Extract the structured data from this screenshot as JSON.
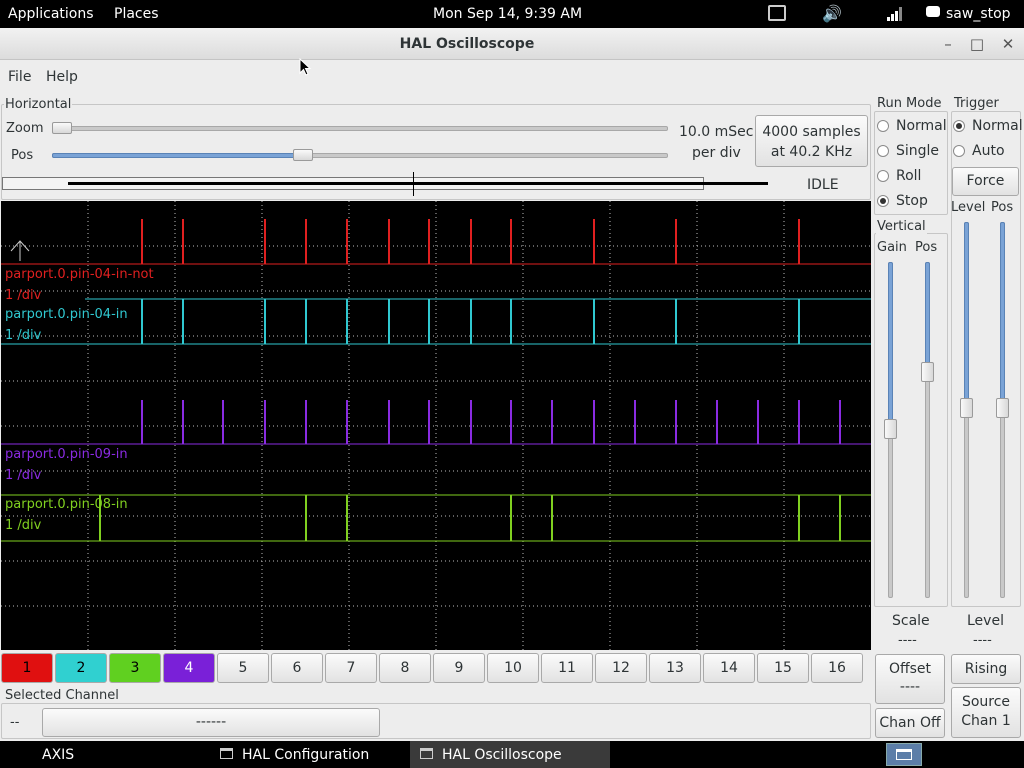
{
  "topbar": {
    "applications": "Applications",
    "places": "Places",
    "clock": "Mon Sep 14,  9:39 AM",
    "user": "saw_stop"
  },
  "window": {
    "title": "HAL Oscilloscope",
    "minimize": "–",
    "maximize": "□",
    "close": "✕"
  },
  "menu": {
    "file": "File",
    "help": "Help"
  },
  "horizontal": {
    "legend": "Horizontal",
    "zoom_label": "Zoom",
    "pos_label": "Pos",
    "zoom_value": 0.0,
    "pos_value": 0.5,
    "rate_line1": "10.0 mSec",
    "rate_line2": "per div",
    "samples_line1": "4000 samples",
    "samples_line2": "at 40.2 KHz",
    "status": "IDLE"
  },
  "run_mode": {
    "legend": "Run Mode",
    "options": [
      "Normal",
      "Single",
      "Roll",
      "Stop"
    ],
    "selected": "Stop"
  },
  "trigger": {
    "legend": "Trigger",
    "options": [
      "Normal",
      "Auto"
    ],
    "selected": "Normal",
    "force": "Force",
    "level_label": "Level",
    "pos_label": "Pos",
    "level_heading": "Level",
    "level_value": "----",
    "edge_button": "Rising",
    "source_line1": "Source",
    "source_line2": "Chan  1"
  },
  "vertical": {
    "legend": "Vertical",
    "gain_label": "Gain",
    "pos_label": "Pos",
    "scale_heading": "Scale",
    "scale_value": "----",
    "offset_line1": "Offset",
    "offset_line2": "----",
    "chan_off": "Chan Off"
  },
  "traces": [
    {
      "name": "parport.0.pin-04-in-not",
      "scale": "1 /div",
      "color": "#e02020"
    },
    {
      "name": "parport.0.pin-04-in",
      "scale": "1 /div",
      "color": "#30c8d0"
    },
    {
      "name": "parport.0.pin-09-in",
      "scale": "1 /div",
      "color": "#8a2be2"
    },
    {
      "name": "parport.0.pin-08-in",
      "scale": "1 /div",
      "color": "#80d020"
    }
  ],
  "channels": [
    "1",
    "2",
    "3",
    "4",
    "5",
    "6",
    "7",
    "8",
    "9",
    "10",
    "11",
    "12",
    "13",
    "14",
    "15",
    "16"
  ],
  "channel_colors": [
    "#e01010",
    "#30d0d0",
    "#60d020",
    "#7a20d8"
  ],
  "selected_channel": {
    "legend": "Selected Channel",
    "value": "--",
    "name": "------"
  },
  "taskbar": {
    "axis": "AXIS",
    "hal_config": "HAL Configuration",
    "hal_scope": "HAL Oscilloscope"
  }
}
